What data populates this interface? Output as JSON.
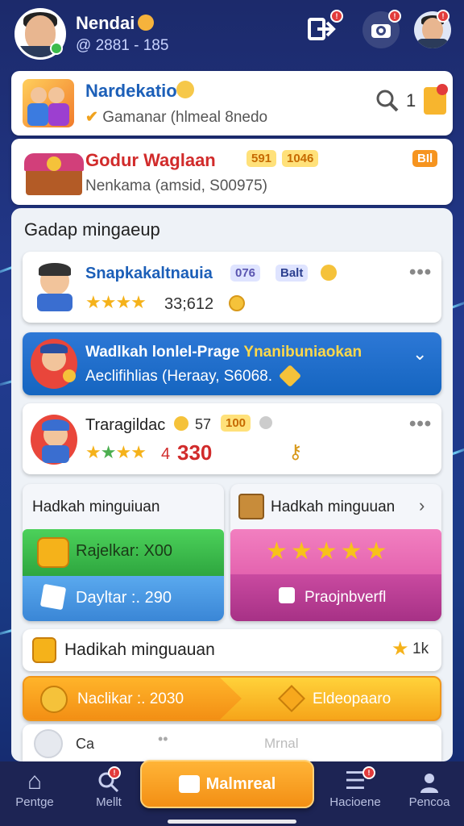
{
  "header": {
    "user_name": "Nendai",
    "user_id": "@ 2881 - 185",
    "icons": [
      "share-icon",
      "camera-icon",
      "profile-avatar"
    ],
    "badges": [
      "!",
      "!",
      "!"
    ]
  },
  "top_cards": [
    {
      "title": "Nardekatio",
      "subtitle": "Gamanar (hlmeal 8nedo",
      "count": "1"
    },
    {
      "title": "Godur Waglaan",
      "badge1": "591",
      "badge2": "1046",
      "badge3": "BIl",
      "subtitle": "Nenkama (amsid, S00975)"
    }
  ],
  "section": {
    "heading": "Gadap mingaeup"
  },
  "list": [
    {
      "title": "Snapkakaltnauia",
      "pill1": "076",
      "pill2": "Balt",
      "rating_text": "33;612"
    },
    {
      "title": "Wadlkah lonlel-Prage",
      "highlight": "Ynanibuniaokan",
      "subtitle": "Aeclifihlias (Heraay, S6068."
    },
    {
      "title": "Traragildac",
      "num": "57",
      "pill": "100",
      "rating_value": "4",
      "price": "330"
    }
  ],
  "tiles": [
    {
      "title": "Hadkah minguiuan",
      "green_label": "Rajelkar: X00",
      "blue_label": "Dayltar :. 290"
    },
    {
      "title": "Hadkah minguuan",
      "pink_label": "Praojnbverfl"
    }
  ],
  "reward": {
    "title": "Hadikah minguauan",
    "count": "1k",
    "yellow_left": "Naclikar :. 2030",
    "yellow_right": "Eldeopaaro"
  },
  "partial_row": {
    "left": "Ca",
    "right": "Mrnal"
  },
  "bottom_nav": {
    "items": [
      {
        "label": "Pentge",
        "icon": "home-icon"
      },
      {
        "label": "Mellt",
        "icon": "search-icon"
      },
      {
        "label": "Hacioene",
        "icon": "news-icon"
      },
      {
        "label": "Pencoa",
        "icon": "user-icon"
      }
    ],
    "center": "Malmreal"
  },
  "colors": {
    "accent": "#1c5fb8",
    "red": "#d12b2b",
    "orange": "#f38f14",
    "blue_bar": "#1565c0"
  }
}
